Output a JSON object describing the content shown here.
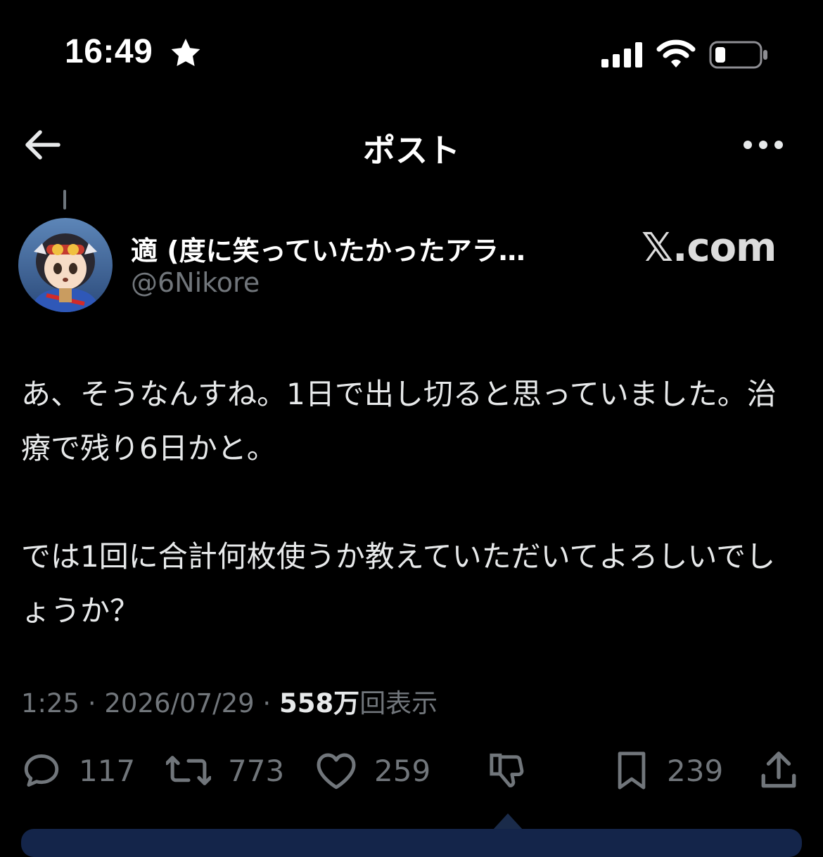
{
  "status_bar": {
    "time": "16:49",
    "star_icon": "star-icon",
    "signal_icon": "cellular-signal-icon",
    "wifi_icon": "wifi-icon",
    "battery_icon": "battery-low-icon"
  },
  "header": {
    "title": "ポスト",
    "back_icon": "arrow-left-icon",
    "more_icon": "more-horizontal-icon"
  },
  "author": {
    "display_name": "適 (度に笑っていたかったアラ…",
    "handle": "@6Nikore"
  },
  "watermark": "𝕏.com",
  "post": {
    "text": "あ、そうなんすね。1日で出し切ると思っていました。治療で残り6日かと。\n\nでは1回に合計何枚使うか教えていただいてよろしいでしょうか？"
  },
  "meta": {
    "time": "1:25",
    "separator": "·",
    "date": "2026/07/29",
    "views_number": "558万",
    "views_label": "回表示"
  },
  "actions": {
    "reply_count": "117",
    "repost_count": "773",
    "like_count": "259",
    "bookmark_count": "239"
  },
  "colors": {
    "background": "#000000",
    "text": "#e7e9ea",
    "secondary": "#71767b",
    "bottom_bar": "#14254a"
  }
}
